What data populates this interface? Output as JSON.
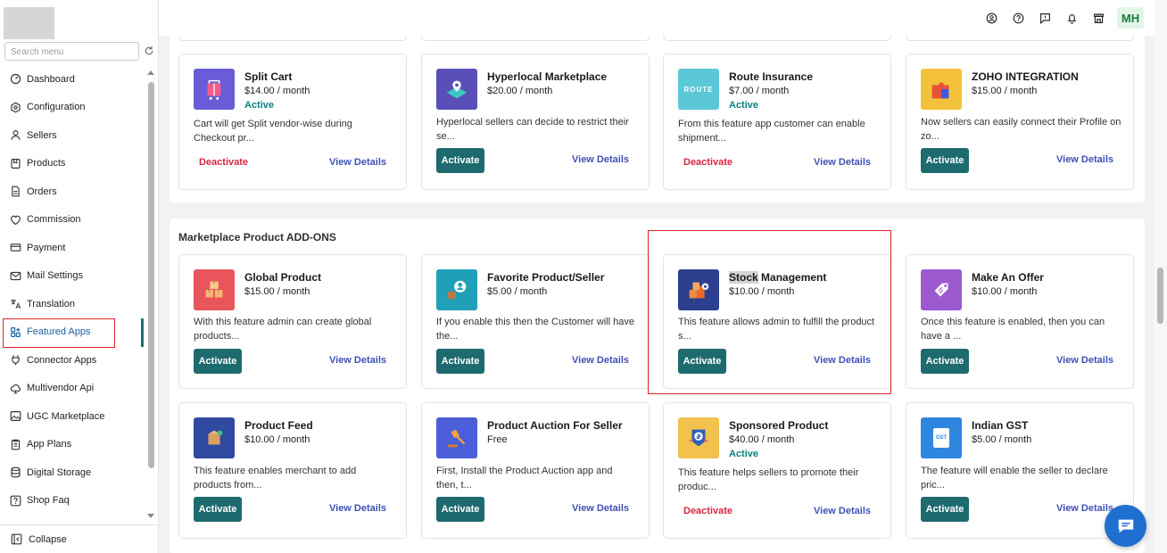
{
  "sidebar": {
    "search_placeholder": "Search menu",
    "items": [
      {
        "label": "Dashboard",
        "icon": "dashboard-icon"
      },
      {
        "label": "Configuration",
        "icon": "configuration-icon"
      },
      {
        "label": "Sellers",
        "icon": "user-icon"
      },
      {
        "label": "Products",
        "icon": "products-icon"
      },
      {
        "label": "Orders",
        "icon": "orders-icon"
      },
      {
        "label": "Commission",
        "icon": "commission-icon"
      },
      {
        "label": "Payment",
        "icon": "payment-icon"
      },
      {
        "label": "Mail Settings",
        "icon": "mail-icon"
      },
      {
        "label": "Translation",
        "icon": "translation-icon"
      },
      {
        "label": "Featured Apps",
        "icon": "apps-grid-icon",
        "active": true
      },
      {
        "label": "Connector Apps",
        "icon": "plug-icon"
      },
      {
        "label": "Multivendor Api",
        "icon": "api-cloud-icon"
      },
      {
        "label": "UGC Marketplace",
        "icon": "image-icon"
      },
      {
        "label": "App Plans",
        "icon": "plans-icon"
      },
      {
        "label": "Digital Storage",
        "icon": "database-icon"
      },
      {
        "label": "Shop Faq",
        "icon": "faq-icon"
      }
    ],
    "collapse_label": "Collapse"
  },
  "topbar": {
    "icons": [
      "account-circle-icon",
      "help-icon",
      "feedback-icon",
      "bell-icon",
      "store-icon"
    ],
    "avatar_initials": "MH"
  },
  "top_section": {
    "cards": [
      {
        "name": "Split Cart",
        "price": "$14.00 / month",
        "status": "Active",
        "description": "Cart will get Split vendor-wise during Checkout pr...",
        "action": "Deactivate",
        "view": "View Details",
        "icon_color": "#6a5cd8"
      },
      {
        "name": "Hyperlocal Marketplace",
        "price": "$20.00 / month",
        "status": "",
        "description": "Hyperlocal sellers can decide to restrict their se...",
        "action": "Activate",
        "view": "View Details",
        "icon_color": "#5a4fb8"
      },
      {
        "name": "Route Insurance",
        "price": "$7.00 / month",
        "status": "Active",
        "description": "From this feature app customer can enable shipment...",
        "action": "Deactivate",
        "view": "View Details",
        "icon_color": "#5bc8d8",
        "icon_text": "ROUTE"
      },
      {
        "name": "ZOHO INTEGRATION",
        "price": "$15.00 / month",
        "status": "",
        "description": "Now sellers can easily connect their Profile on zo...",
        "action": "Activate",
        "view": "View Details",
        "icon_color": "#f3c23a"
      }
    ]
  },
  "addons_section": {
    "title": "Marketplace Product ADD-ONS",
    "cards": [
      {
        "name": "Global Product",
        "price": "$15.00 / month",
        "status": "",
        "description": "With this feature admin can create global products...",
        "action": "Activate",
        "view": "View Details",
        "icon_color": "#e8555a"
      },
      {
        "name": "Favorite Product/Seller",
        "price": "$5.00 / month",
        "status": "",
        "description": "If you enable this then the Customer will have the...",
        "action": "Activate",
        "view": "View Details",
        "icon_color": "#1fa0b8"
      },
      {
        "name_highlight": "Stock",
        "name_rest": " Management",
        "price": "$10.00 / month",
        "status": "",
        "description": "This feature allows admin to fulfill the product s...",
        "action": "Activate",
        "view": "View Details",
        "icon_color": "#2c3f8f"
      },
      {
        "name": "Make An Offer",
        "price": "$10.00 / month",
        "status": "",
        "description": "Once this feature is enabled, then you can have a ...",
        "action": "Activate",
        "view": "View Details",
        "icon_color": "#9b59d0"
      },
      {
        "name": "Product Feed",
        "price": "$10.00 / month",
        "status": "",
        "description": "This feature enables merchant to add products from...",
        "action": "Activate",
        "view": "View Details",
        "icon_color": "#2f4a9e"
      },
      {
        "name": "Product Auction For Seller",
        "price": "Free",
        "status": "",
        "description": "First, Install the Product Auction app and then, t...",
        "action": "Activate",
        "view": "View Details",
        "icon_color": "#4a5fd8"
      },
      {
        "name": "Sponsored Product",
        "price": "$40.00 / month",
        "status": "Active",
        "description": "This feature helps sellers to promote their produc...",
        "action": "Deactivate",
        "view": "View Details",
        "icon_color": "#f2c14e"
      },
      {
        "name": "Indian GST",
        "price": "$5.00 / month",
        "status": "",
        "description": "The feature will enable the seller to declare pric...",
        "action": "Activate",
        "view": "View Details",
        "icon_color": "#2e86de",
        "icon_text": "GST"
      }
    ]
  },
  "chat": {
    "icon": "chat-icon"
  }
}
